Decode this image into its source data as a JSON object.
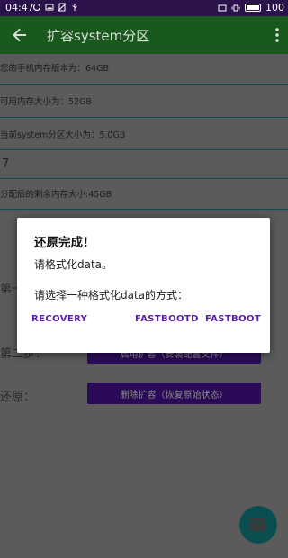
{
  "status_bar": {
    "time": "04:47",
    "battery": "100",
    "icons": [
      "sync-icon",
      "image-icon",
      "sim-off-icon",
      "usb-icon",
      "cast-icon",
      "vibrate-icon",
      "battery-icon"
    ]
  },
  "app_bar": {
    "title": "扩容system分区",
    "back_icon": "arrow-left-icon",
    "menu_icon": "more-vert-icon"
  },
  "info": {
    "phone_storage": "您的手机内存版本为：64GB",
    "available_storage": "可用内存大小为：52GB",
    "system_partition": "当前system分区大小为：5.0GB",
    "input_value": "7",
    "remaining": "分配后的剩余内存大小:45GB"
  },
  "steps": {
    "step1_label": "第一",
    "step2_label": "第二步：",
    "step2_button": "启用扩容（安装配置文件）",
    "restore_label": "还原：",
    "restore_button": "删除扩容（恢复原始状态）"
  },
  "fab": {
    "icon": "email-icon"
  },
  "dialog": {
    "title": "还原完成！",
    "message1": "请格式化data。",
    "message2": "请选择一种格式化data的方式：",
    "buttons": [
      "RECOVERY",
      "FASTBOOTD",
      "FASTBOOT"
    ]
  },
  "colors": {
    "status_bar": "#2b124a",
    "app_bar": "#1a591e",
    "accent_teal": "#0a4d4f",
    "button_purple": "#2b0b57",
    "dialog_button": "#5b1ca8"
  }
}
